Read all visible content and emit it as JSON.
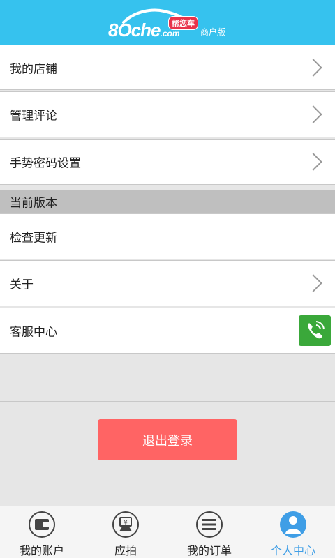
{
  "header": {
    "logo_main": "8Oche",
    "logo_dotcom": ".com",
    "logo_badge": "帮您车",
    "logo_sub": "商户版"
  },
  "menu": [
    {
      "label": "我的店铺"
    },
    {
      "label": "管理评论"
    },
    {
      "label": "手势密码设置"
    }
  ],
  "version_section": {
    "title": "当前版本"
  },
  "version_menu": [
    {
      "label": "检查更新"
    },
    {
      "label": "关于"
    },
    {
      "label": "客服中心"
    }
  ],
  "logout_label": "退出登录",
  "tabs": [
    {
      "label": "我的账户",
      "icon": "wallet-icon",
      "active": false
    },
    {
      "label": "应拍",
      "icon": "bid-icon",
      "active": false
    },
    {
      "label": "我的订单",
      "icon": "list-icon",
      "active": false
    },
    {
      "label": "个人中心",
      "icon": "person-icon",
      "active": true
    }
  ],
  "colors": {
    "header": "#36c2ee",
    "logout": "#ff6464",
    "phone": "#3aa83a",
    "active_tab": "#3f9ee6"
  }
}
